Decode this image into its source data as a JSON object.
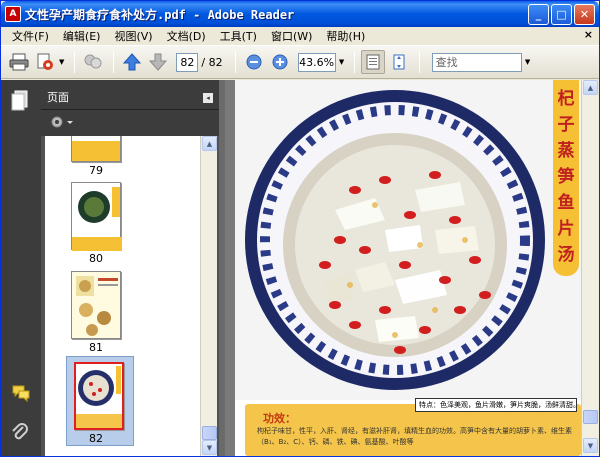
{
  "window": {
    "title": "文性孕产期食疗食补处方.pdf - Adobe Reader",
    "icon_label": "A",
    "minimize_label": "_",
    "maximize_label": "□",
    "close_label": "✕"
  },
  "menu": {
    "items": [
      {
        "label": "文件(F)"
      },
      {
        "label": "编辑(E)"
      },
      {
        "label": "视图(V)"
      },
      {
        "label": "文档(D)"
      },
      {
        "label": "工具(T)"
      },
      {
        "label": "窗口(W)"
      },
      {
        "label": "帮助(H)"
      }
    ],
    "close_label": "×"
  },
  "toolbar": {
    "current_page": "82",
    "page_total": "/ 82",
    "zoom": "43.6%",
    "search_placeholder": "查找"
  },
  "nav_panel": {
    "title": "页面",
    "collapse_label": "◂",
    "thumbnails": [
      {
        "label": "79"
      },
      {
        "label": "80"
      },
      {
        "label": "81"
      },
      {
        "label": "82"
      }
    ],
    "selected_page": "82"
  },
  "document": {
    "recipe_title_chars": [
      "杞",
      "子",
      "蒸",
      "笋",
      "鱼",
      "片",
      "汤"
    ],
    "feature_text": "特点：色泽美观，鱼片滑嫩，笋片爽脆，汤鲜清甜。",
    "effect_label": "功效：",
    "effect_text": "枸杞子味甘，性平，入肝、肾经，有滋补肝肾，填精生血的功效。高笋中含有大量的胡萝卜素、维生素（B₁、B₂、C）、钙、磷、铁、碘、氨基酸、叶酸等"
  },
  "colors": {
    "title_bar": "#0058e0",
    "recipe_banner": "#f6c034",
    "recipe_text": "#c02020",
    "effect_box": "#f4c54a",
    "selected_thumb": "#b7cde9"
  }
}
